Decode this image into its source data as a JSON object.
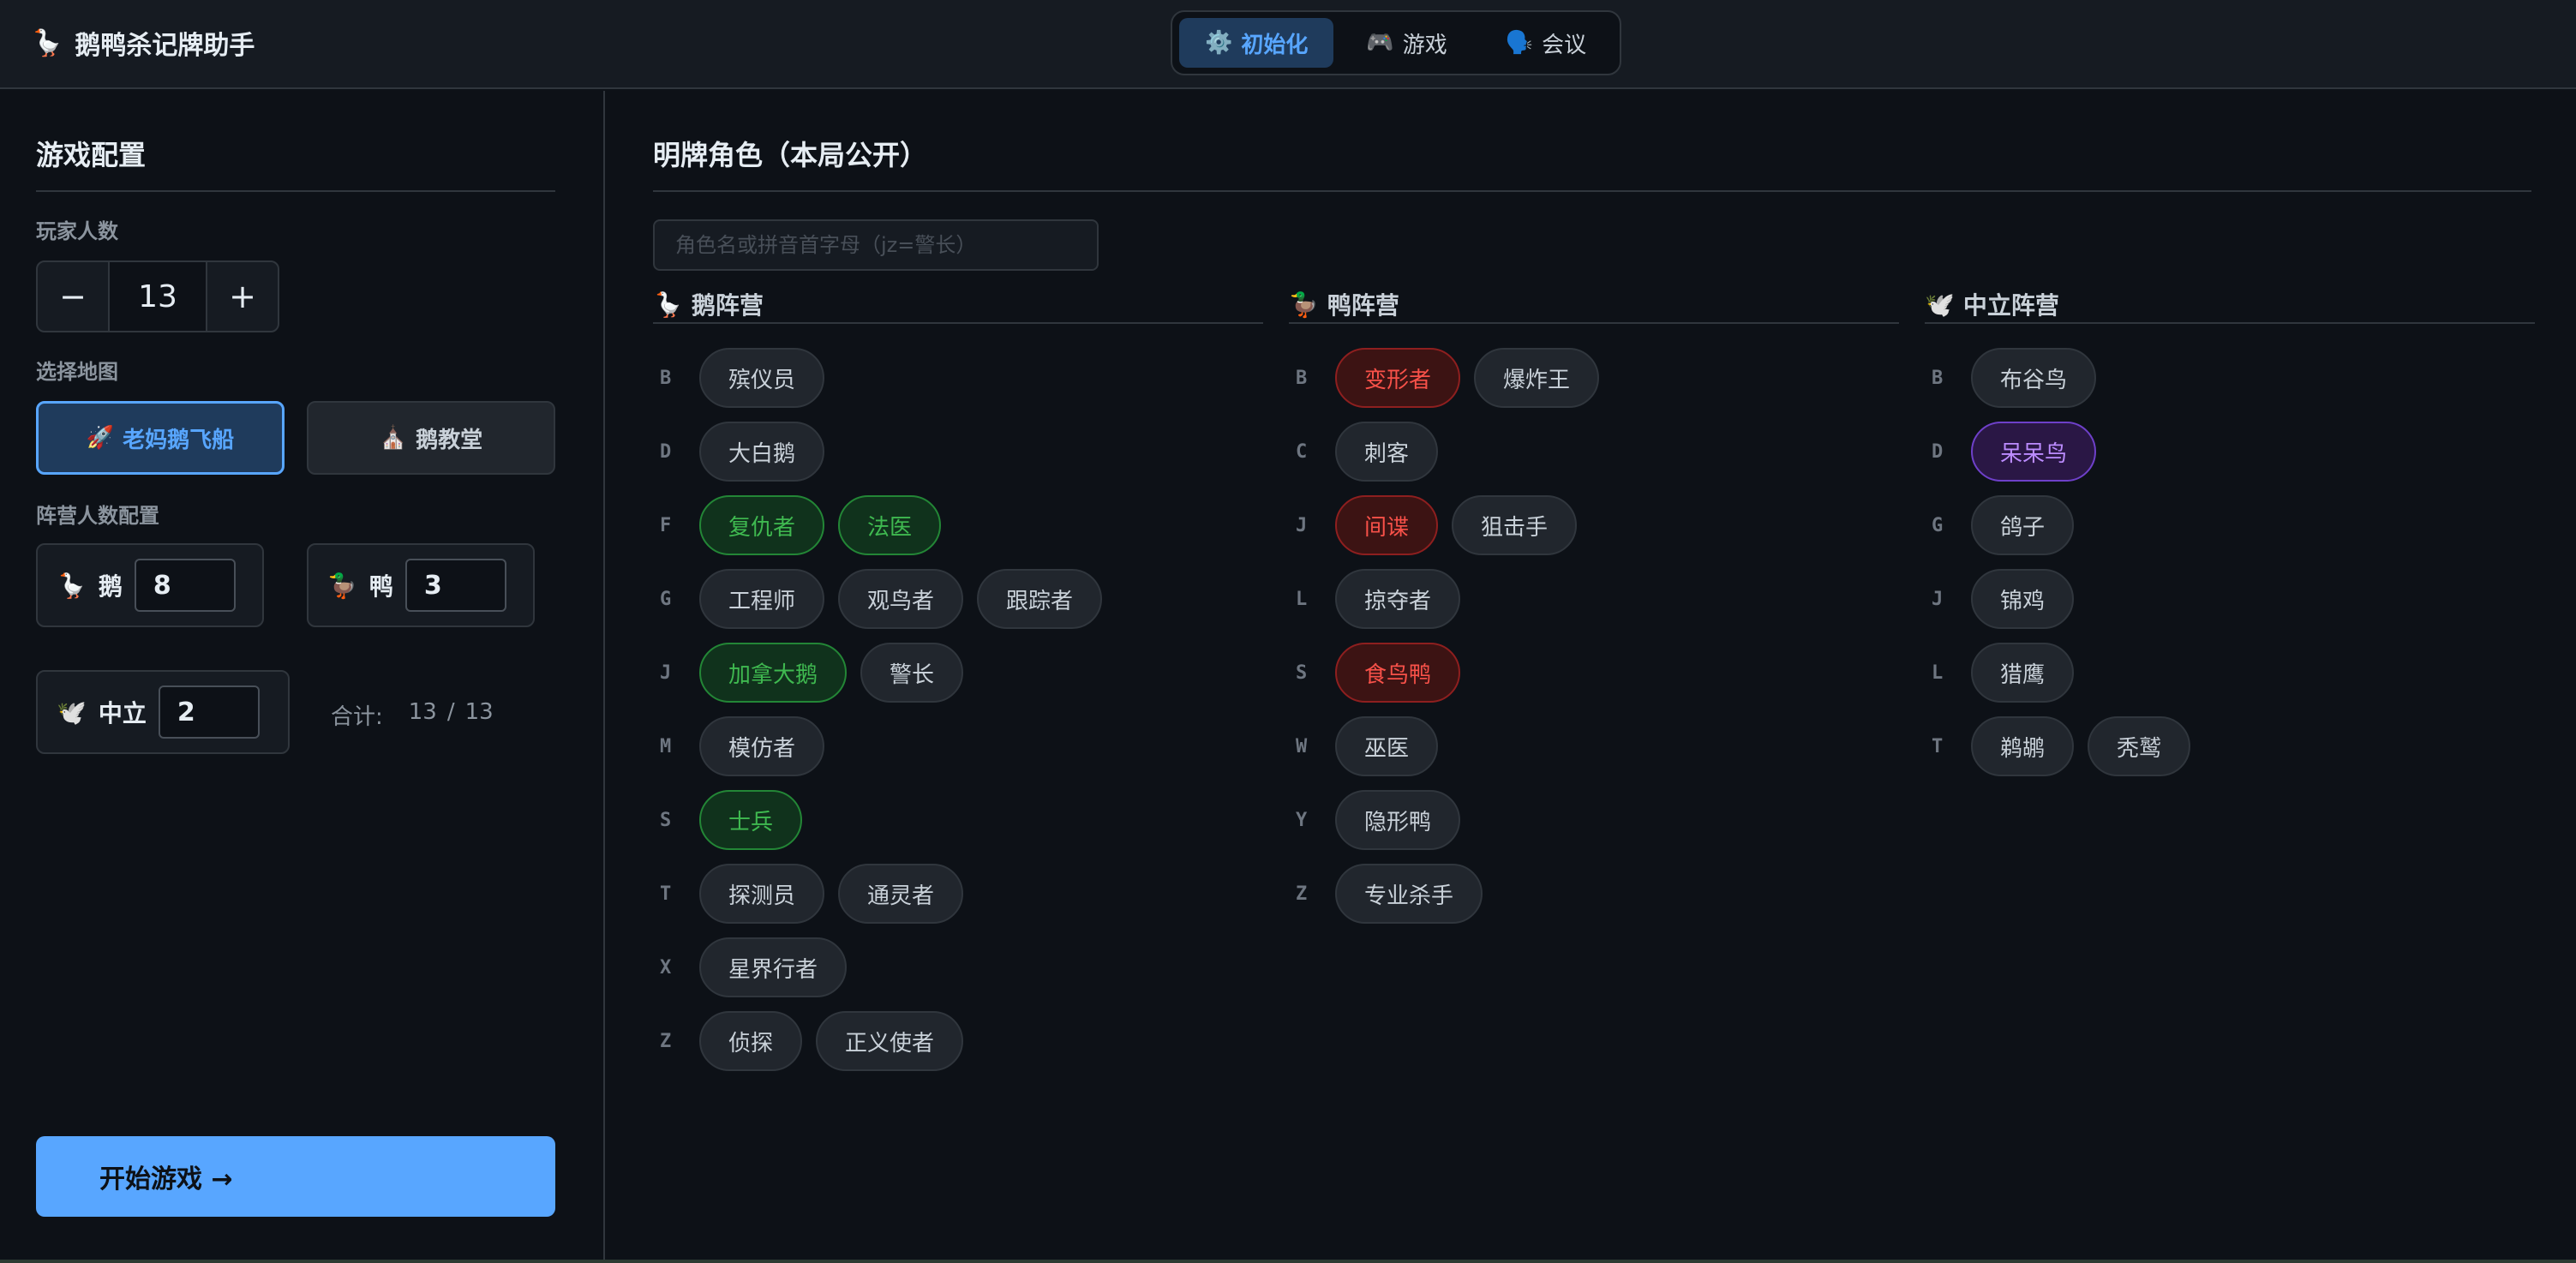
{
  "app": {
    "title": "鹅鸭杀记牌助手",
    "logo_icon": "🪿"
  },
  "tabs": [
    {
      "label": "初始化",
      "icon": "⚙️",
      "active": true
    },
    {
      "label": "游戏",
      "icon": "🎮",
      "active": false
    },
    {
      "label": "会议",
      "icon": "🗣️",
      "active": false
    }
  ],
  "sidebar": {
    "title": "游戏配置",
    "players": {
      "label": "玩家人数",
      "minus": "−",
      "value": "13",
      "plus": "+"
    },
    "map": {
      "label": "选择地图",
      "options": [
        {
          "label": "老妈鹅飞船",
          "icon": "🚀",
          "selected": true
        },
        {
          "label": "鹅教堂",
          "icon": "⛪",
          "selected": false
        }
      ]
    },
    "teams": {
      "label": "阵营人数配置",
      "goose": {
        "icon": "🪿",
        "label": "鹅",
        "value": "8"
      },
      "duck": {
        "icon": "🦆",
        "label": "鸭",
        "value": "3"
      },
      "neutral": {
        "icon": "🕊️",
        "label": "中立",
        "value": "2"
      }
    },
    "total": {
      "label": "合计:",
      "current": "13",
      "sep": "/",
      "max": "13"
    },
    "start_button": "开始游戏 →"
  },
  "main": {
    "title": "明牌角色（本局公开）",
    "search_placeholder": "角色名或拼音首字母（jz=警长）",
    "columns": [
      {
        "icon": "🪿",
        "title": "鹅阵营",
        "rows": [
          {
            "letter": "B",
            "chips": [
              {
                "label": "殡仪员",
                "state": "normal"
              }
            ]
          },
          {
            "letter": "D",
            "chips": [
              {
                "label": "大白鹅",
                "state": "normal"
              }
            ]
          },
          {
            "letter": "F",
            "chips": [
              {
                "label": "复仇者",
                "state": "green"
              },
              {
                "label": "法医",
                "state": "green"
              }
            ]
          },
          {
            "letter": "G",
            "chips": [
              {
                "label": "工程师",
                "state": "normal"
              },
              {
                "label": "观鸟者",
                "state": "normal"
              },
              {
                "label": "跟踪者",
                "state": "normal"
              }
            ]
          },
          {
            "letter": "J",
            "chips": [
              {
                "label": "加拿大鹅",
                "state": "green"
              },
              {
                "label": "警长",
                "state": "normal"
              }
            ]
          },
          {
            "letter": "M",
            "chips": [
              {
                "label": "模仿者",
                "state": "normal"
              }
            ]
          },
          {
            "letter": "S",
            "chips": [
              {
                "label": "士兵",
                "state": "green"
              }
            ]
          },
          {
            "letter": "T",
            "chips": [
              {
                "label": "探测员",
                "state": "normal"
              },
              {
                "label": "通灵者",
                "state": "normal"
              }
            ]
          },
          {
            "letter": "X",
            "chips": [
              {
                "label": "星界行者",
                "state": "normal"
              }
            ]
          },
          {
            "letter": "Z",
            "chips": [
              {
                "label": "侦探",
                "state": "normal"
              },
              {
                "label": "正义使者",
                "state": "normal"
              }
            ]
          }
        ]
      },
      {
        "icon": "🦆",
        "title": "鸭阵营",
        "rows": [
          {
            "letter": "B",
            "chips": [
              {
                "label": "变形者",
                "state": "red"
              },
              {
                "label": "爆炸王",
                "state": "normal"
              }
            ]
          },
          {
            "letter": "C",
            "chips": [
              {
                "label": "刺客",
                "state": "normal"
              }
            ]
          },
          {
            "letter": "J",
            "chips": [
              {
                "label": "间谍",
                "state": "red"
              },
              {
                "label": "狙击手",
                "state": "normal"
              }
            ]
          },
          {
            "letter": "L",
            "chips": [
              {
                "label": "掠夺者",
                "state": "normal"
              }
            ]
          },
          {
            "letter": "S",
            "chips": [
              {
                "label": "食鸟鸭",
                "state": "red"
              }
            ]
          },
          {
            "letter": "W",
            "chips": [
              {
                "label": "巫医",
                "state": "normal"
              }
            ]
          },
          {
            "letter": "Y",
            "chips": [
              {
                "label": "隐形鸭",
                "state": "normal"
              }
            ]
          },
          {
            "letter": "Z",
            "chips": [
              {
                "label": "专业杀手",
                "state": "normal"
              }
            ]
          }
        ]
      },
      {
        "icon": "🕊️",
        "title": "中立阵营",
        "rows": [
          {
            "letter": "B",
            "chips": [
              {
                "label": "布谷鸟",
                "state": "normal"
              }
            ]
          },
          {
            "letter": "D",
            "chips": [
              {
                "label": "呆呆鸟",
                "state": "purple"
              }
            ]
          },
          {
            "letter": "G",
            "chips": [
              {
                "label": "鸽子",
                "state": "normal"
              }
            ]
          },
          {
            "letter": "J",
            "chips": [
              {
                "label": "锦鸡",
                "state": "normal"
              }
            ]
          },
          {
            "letter": "L",
            "chips": [
              {
                "label": "猎鹰",
                "state": "normal"
              }
            ]
          },
          {
            "letter": "T",
            "chips": [
              {
                "label": "鹈鹕",
                "state": "normal"
              },
              {
                "label": "秃鹫",
                "state": "normal"
              }
            ]
          }
        ]
      }
    ]
  },
  "colors": {
    "background": "#0d1117",
    "panel": "#161b22",
    "border": "#30363d",
    "accent": "#58a6ff",
    "goose_selected": "#3fb950",
    "duck_selected": "#f85149",
    "neutral_selected": "#bc8cff"
  }
}
